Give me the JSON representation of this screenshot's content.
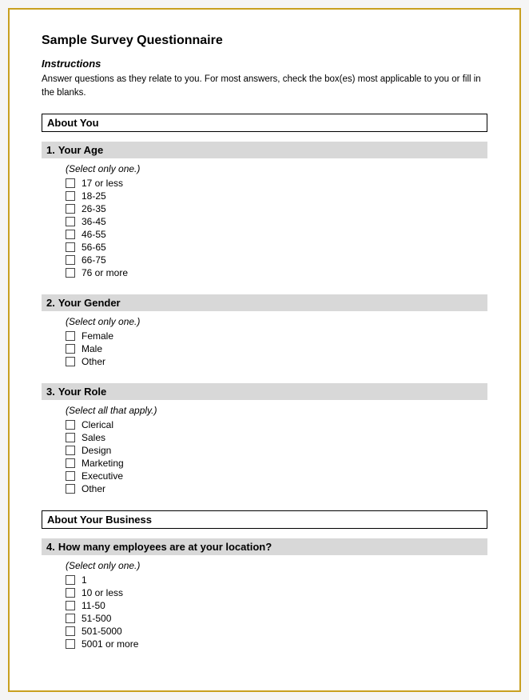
{
  "title": "Sample Survey Questionnaire",
  "instructions": {
    "heading": "Instructions",
    "text": "Answer questions as they relate to you. For most answers, check the box(es) most applicable to you or fill in the blanks."
  },
  "sections": [
    {
      "id": "about-you",
      "header": "About You",
      "questions": [
        {
          "number": "1.",
          "text": "Your Age",
          "select_instruction": "(Select only one.)",
          "options": [
            "17 or less",
            "18-25",
            "26-35",
            "36-45",
            "46-55",
            "56-65",
            "66-75",
            "76 or more"
          ]
        },
        {
          "number": "2.",
          "text": "Your Gender",
          "select_instruction": "(Select only one.)",
          "options": [
            "Female",
            "Male",
            "Other"
          ]
        },
        {
          "number": "3.",
          "text": "Your Role",
          "select_instruction": "(Select all that apply.)",
          "options": [
            "Clerical",
            "Sales",
            "Design",
            "Marketing",
            "Executive",
            "Other"
          ]
        }
      ]
    },
    {
      "id": "about-your-business",
      "header": "About Your Business",
      "questions": [
        {
          "number": "4.",
          "text": "How many employees are at your location?",
          "select_instruction": "(Select only one.)",
          "options": [
            "1",
            "10 or less",
            "11-50",
            "51-500",
            "501-5000",
            "5001 or more"
          ]
        }
      ]
    }
  ]
}
